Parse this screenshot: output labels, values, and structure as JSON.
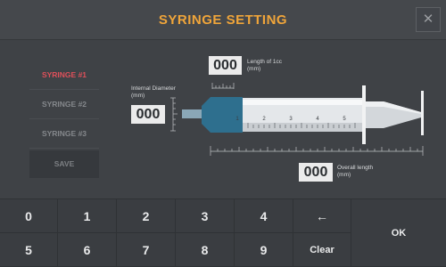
{
  "header": {
    "title": "SYRINGE SETTING",
    "close_symbol": "✕"
  },
  "sidebar": {
    "items": [
      {
        "label": "SYRINGE #1",
        "active": true
      },
      {
        "label": "SYRINGE #2",
        "active": false
      },
      {
        "label": "SYRINGE #3",
        "active": false
      }
    ],
    "save_label": "SAVE"
  },
  "fields": {
    "length_1cc": {
      "value": "000",
      "label_line1": "Length of 1cc",
      "label_line2": "(mm)"
    },
    "internal_diameter": {
      "value": "000",
      "label_line1": "Internal Diameter",
      "label_line2": "(mm)"
    },
    "overall_length": {
      "value": "000",
      "label_line1": "Overall length",
      "label_line2": "(mm)"
    }
  },
  "syringe": {
    "scale_numbers": [
      "1",
      "2",
      "3",
      "4",
      "5"
    ]
  },
  "keypad": {
    "row1": [
      "0",
      "1",
      "2",
      "3",
      "4",
      "←"
    ],
    "row2": [
      "5",
      "6",
      "7",
      "8",
      "9",
      "Clear"
    ],
    "ok_label": "OK"
  },
  "colors": {
    "accent": "#f0a53a",
    "active": "#e0505a",
    "hub": "#2e6f8e"
  }
}
